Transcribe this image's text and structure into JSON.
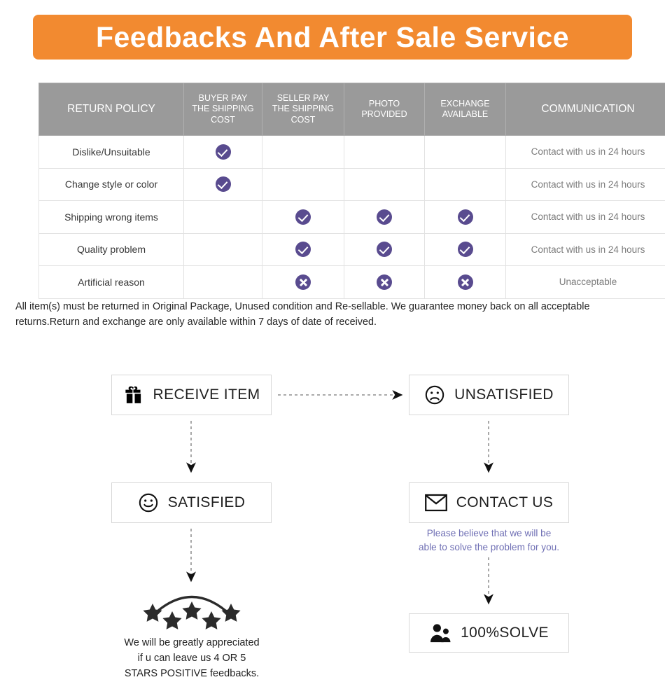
{
  "banner": {
    "title": "Feedbacks And After Sale Service"
  },
  "colors": {
    "banner_bg": "#f28a30",
    "table_header_bg": "#9a9a9a",
    "mark_purple": "#594b8f",
    "contact_note_text": "#6f6fb4"
  },
  "table": {
    "columns": [
      "RETURN POLICY",
      "BUYER PAY THE SHIPPING COST",
      "SELLER PAY THE SHIPPING COST",
      "PHOTO PROVIDED",
      "EXCHANGE AVAILABLE",
      "COMMUNICATION"
    ],
    "column_lines": [
      [
        "RETURN POLICY"
      ],
      [
        "BUYER PAY",
        "THE SHIPPING",
        "COST"
      ],
      [
        "SELLER PAY",
        "THE SHIPPING",
        "COST"
      ],
      [
        "PHOTO",
        "PROVIDED"
      ],
      [
        "EXCHANGE",
        "AVAILABLE"
      ],
      [
        "COMMUNICATION"
      ]
    ],
    "rows": [
      {
        "reason": "Dislike/Unsuitable",
        "buyer_pay": "check",
        "seller_pay": "",
        "photo": "",
        "exchange": "",
        "communication": "Contact with us in 24 hours"
      },
      {
        "reason": "Change style or color",
        "buyer_pay": "check",
        "seller_pay": "",
        "photo": "",
        "exchange": "",
        "communication": "Contact with us in 24 hours"
      },
      {
        "reason": "Shipping wrong items",
        "buyer_pay": "",
        "seller_pay": "check",
        "photo": "check",
        "exchange": "check",
        "communication": "Contact with us in 24 hours"
      },
      {
        "reason": "Quality problem",
        "buyer_pay": "",
        "seller_pay": "check",
        "photo": "check",
        "exchange": "check",
        "communication": "Contact with us in 24 hours"
      },
      {
        "reason": "Artificial reason",
        "buyer_pay": "",
        "seller_pay": "cross",
        "photo": "cross",
        "exchange": "cross",
        "communication": "Unacceptable"
      }
    ]
  },
  "note": "All item(s) must be returned in Original Package, Unused condition and Re-sellable. We guarantee money back on all acceptable returns.Return and exchange are only available within 7 days of date of received.",
  "flow": {
    "boxes": {
      "receive": {
        "label": "RECEIVE ITEM",
        "icon": "gift-icon"
      },
      "unsatisfied": {
        "label": "UNSATISFIED",
        "icon": "frowning-face-icon"
      },
      "satisfied": {
        "label": "SATISFIED",
        "icon": "smiling-face-icon"
      },
      "contact": {
        "label": "CONTACT US",
        "icon": "envelope-icon"
      },
      "solve": {
        "label": "100%SOLVE",
        "icon": "people-icon"
      }
    },
    "contact_note_lines": [
      "Please believe that we will be",
      "able to solve the problem for you."
    ],
    "stars_note_lines": [
      "We will be greatly appreciated",
      "if u can leave us 4 OR 5",
      "STARS POSITIVE feedbacks."
    ],
    "stars_count": 5
  }
}
